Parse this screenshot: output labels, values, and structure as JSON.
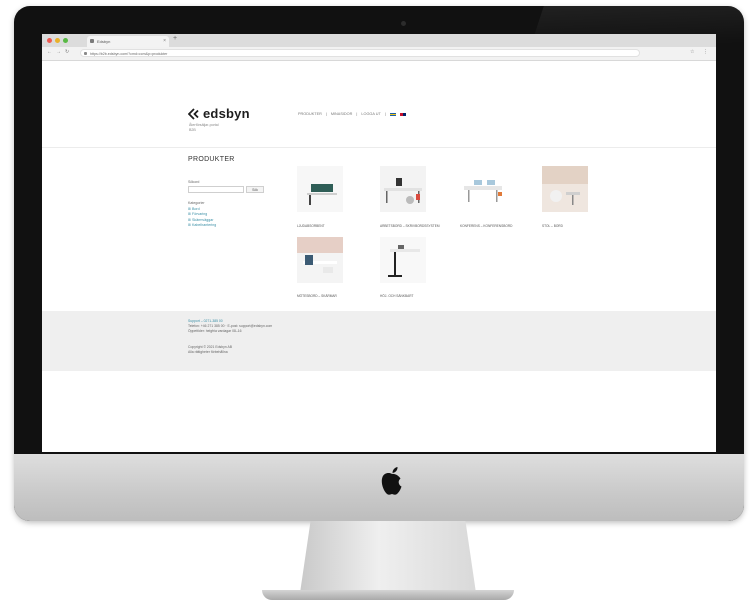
{
  "browser": {
    "tab_title": "Edsbyn",
    "address_url": "https://b2b.edsbyn.com/?cmd=ccm&p=produkter"
  },
  "site": {
    "logo_text": "edsbyn",
    "logo_sub_lines": [
      "Återförsäljar-portal",
      "B2B"
    ],
    "nav_items": [
      "PRODUKTER",
      "MINASIDOR",
      "LOGGA UT"
    ]
  },
  "page": {
    "title": "PRODUKTER",
    "search_label": "Sökord",
    "search_button": "Sök",
    "categories_heading": "Kategorier",
    "categories": [
      "Bord",
      "Förvaring",
      "Skärmväggar",
      "Kabelhantering"
    ]
  },
  "products": [
    {
      "caption": "Ljudabsorbent"
    },
    {
      "caption": "Arbetsbord – Skrivbordssystem"
    },
    {
      "caption": "Konferens – Konferensbord"
    },
    {
      "caption": "Stol – Bord"
    },
    {
      "caption": "Mötesbord – Skärmar"
    },
    {
      "caption": "Höj- och sänkbart"
    }
  ],
  "footer": {
    "lines_1": [
      "Support – 0271-385 00",
      "Telefon: +46 271 385 00 · E-post: support@edsbyn.com",
      "Öppettider: helgfria vardagar 08–16"
    ],
    "lines_2": [
      "Copyright © 2021 Edsbyn AB",
      "Alla rättigheter förbehållna"
    ]
  },
  "colors": {
    "accent_link": "#3a8fa6",
    "footer_bg": "#efefef",
    "traffic_red": "#ef5a52",
    "traffic_yellow": "#e9b12a",
    "traffic_green": "#58b944"
  }
}
